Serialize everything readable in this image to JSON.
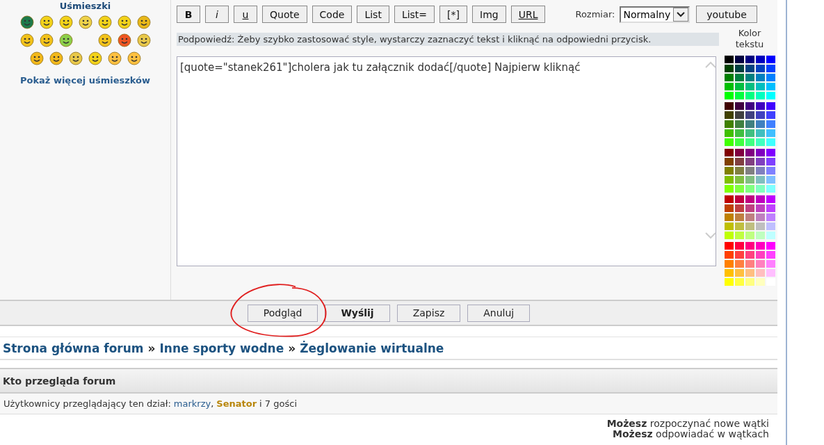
{
  "smilies": {
    "title": "Uśmieszki",
    "more_link": "Pokaż więcej uśmieszków"
  },
  "toolbar": {
    "buttons": [
      {
        "label": "B",
        "kind": "bold"
      },
      {
        "label": "i",
        "kind": "italic"
      },
      {
        "label": "u",
        "kind": "underline"
      },
      {
        "label": "Quote",
        "kind": "plain"
      },
      {
        "label": "Code",
        "kind": "plain"
      },
      {
        "label": "List",
        "kind": "plain"
      },
      {
        "label": "List=",
        "kind": "plain"
      },
      {
        "label": "[*]",
        "kind": "plain"
      },
      {
        "label": "Img",
        "kind": "plain"
      },
      {
        "label": "URL",
        "kind": "underline"
      }
    ],
    "size_label": "Rozmiar:",
    "size_value": "Normalny",
    "extra_button": "youtube"
  },
  "hint": "Podpowiedź: Żeby szybko zastosować style, wystarczy zaznaczyć tekst i kliknąć na odpowiedni przycisk.",
  "message": "[quote=\"stanek261\"]cholera jak tu załącznik dodać[/quote] Najpierw kliknąć",
  "palette_title": "Kolor tekstu",
  "actions": [
    {
      "label": "Podgląd",
      "primary": false
    },
    {
      "label": "Wyślij",
      "primary": true
    },
    {
      "label": "Zapisz",
      "primary": false
    },
    {
      "label": "Anuluj",
      "primary": false
    }
  ],
  "breadcrumbs": [
    "Strona główna forum",
    "Inne sporty wodne",
    "Żeglowanie wirtualne"
  ],
  "breadcrumb_separator": "»",
  "who": {
    "title": "Kto przegląda forum",
    "prefix": "Użytkownicy przeglądający ten dział:",
    "separator": ",",
    "users": [
      {
        "name": "markrzy",
        "color": "#2a5d8f"
      },
      {
        "name": "Senator",
        "color": "#b8860b"
      }
    ],
    "guests": "i 7 gości"
  },
  "permissions": [
    "**Możesz** rozpoczynać nowe wątki",
    "**Możesz** odpowiadać w wątkach"
  ]
}
